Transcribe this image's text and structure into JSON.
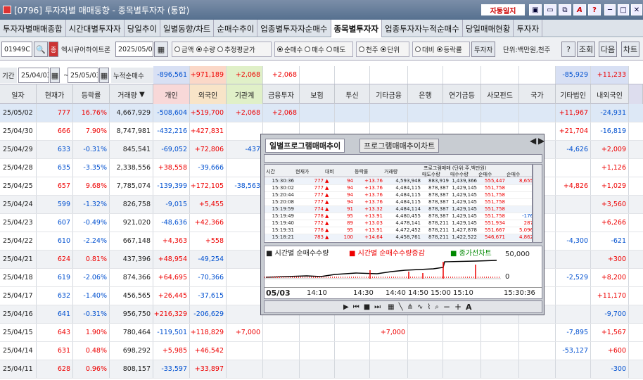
{
  "window": {
    "title": "[0796] 투자자별 매매동향 - 종목별투자자 (통합)",
    "btn_auto_lock": "자동일지",
    "btn_a": "A",
    "btn_q": "?"
  },
  "tabs": [
    "투자자별매매종합",
    "시간대별투자자",
    "당일추이",
    "일별동향/차트",
    "순매수추이",
    "업종별투자자순매수",
    "종목별투자자",
    "업종투자자누적순매수",
    "당일매매현황",
    "투자자"
  ],
  "toolbar": {
    "code": "01949C",
    "stock_name": "엑시큐어하이트론",
    "date": "2025/05/03",
    "r1_a": "금액",
    "r1_b": "수량",
    "r1_c": "추정평균가",
    "r2_a": "순매수",
    "r2_b": "매수",
    "r2_c": "매도",
    "r3_a": "천주",
    "r3_b": "단위",
    "r4_a": "대비",
    "r4_b": "등락률",
    "investor_btn": "투자자",
    "unit": "단위:백만원,천주",
    "help": "?",
    "query": "조회",
    "next": "다음",
    "chart": "차트"
  },
  "period": {
    "label": "기간",
    "from": "25/04/03",
    "to": "25/05/03",
    "tilde": "~",
    "cum_label": "누적순매수",
    "values": [
      "-896,561",
      "+971,189",
      "+2,068",
      "",
      "+2,068",
      "",
      "",
      "",
      "",
      "",
      "",
      "-85,929",
      "+11,233"
    ]
  },
  "columns": [
    "일자",
    "현재가",
    "등락률",
    "거래량",
    "개인",
    "외국인",
    "기관계",
    "금융투자",
    "보험",
    "투신",
    "기타금융",
    "은행",
    "연기금등",
    "사모펀드",
    "국가",
    "기타법인",
    "내외국인"
  ],
  "rows": [
    {
      "d": "25/05/02",
      "p": "777",
      "r": "16.76%",
      "v": "4,667,929",
      "i": "-508,604",
      "f": "+519,700",
      "g": "+2,068",
      "fi": "+2,068",
      "ins": "",
      "tr": "",
      "ef": "",
      "bk": "",
      "pn": "",
      "pe": "",
      "nt": "",
      "oc": "+11,967",
      "fo": "-24,931",
      "hl": true
    },
    {
      "d": "25/04/30",
      "p": "666",
      "r": "7.90%",
      "v": "8,747,981",
      "i": "-432,216",
      "f": "+427,831",
      "g": "",
      "fi": "",
      "oc": "+21,704",
      "fo": "-16,819"
    },
    {
      "d": "25/04/29",
      "p": "633",
      "r": "-0.31%",
      "v": "845,541",
      "i": "-69,052",
      "f": "+72,806",
      "g": "-437",
      "fi": "",
      "oc": "-4,626",
      "fo": "+2,009"
    },
    {
      "d": "25/04/28",
      "p": "635",
      "r": "-3.35%",
      "v": "2,338,556",
      "i": "+38,558",
      "f": "-39,666",
      "g": "",
      "fi": "",
      "oc": "",
      "fo": "+1,126"
    },
    {
      "d": "25/04/25",
      "p": "657",
      "r": "9.68%",
      "v": "7,785,074",
      "i": "-139,399",
      "f": "+172,105",
      "g": "-38,563",
      "fi": "",
      "oc": "+4,826",
      "fo": "+1,029"
    },
    {
      "d": "25/04/24",
      "p": "599",
      "r": "-1.32%",
      "v": "826,758",
      "i": "-9,015",
      "f": "+5,455",
      "g": "",
      "fi": "",
      "oc": "",
      "fo": "+3,560"
    },
    {
      "d": "25/04/23",
      "p": "607",
      "r": "-0.49%",
      "v": "921,020",
      "i": "-48,636",
      "f": "+42,366",
      "g": "",
      "fi": "",
      "oc": "",
      "fo": "+6,266"
    },
    {
      "d": "25/04/22",
      "p": "610",
      "r": "-2.24%",
      "v": "667,148",
      "i": "+4,363",
      "f": "+558",
      "g": "",
      "fi": "",
      "oc": "-4,300",
      "fo": "-621"
    },
    {
      "d": "25/04/21",
      "p": "624",
      "r": "0.81%",
      "v": "437,396",
      "i": "+48,954",
      "f": "-49,254",
      "g": "",
      "fi": "",
      "oc": "",
      "fo": "+300"
    },
    {
      "d": "25/04/18",
      "p": "619",
      "r": "-2.06%",
      "v": "874,366",
      "i": "+64,695",
      "f": "-70,366",
      "g": "",
      "fi": "",
      "oc": "-2,529",
      "fo": "+8,200"
    },
    {
      "d": "25/04/17",
      "p": "632",
      "r": "-1.40%",
      "v": "456,565",
      "i": "+26,445",
      "f": "-37,615",
      "g": "",
      "fi": "",
      "oc": "",
      "fo": "+11,170"
    },
    {
      "d": "25/04/16",
      "p": "641",
      "r": "-0.31%",
      "v": "956,750",
      "i": "+216,329",
      "f": "-206,629",
      "g": "",
      "fi": "",
      "oc": "",
      "fo": "-9,700"
    },
    {
      "d": "25/04/15",
      "p": "643",
      "r": "1.90%",
      "v": "780,464",
      "i": "-119,501",
      "f": "+118,829",
      "g": "+7,000",
      "fi": "",
      "ef": "+7,000",
      "oc": "-7,895",
      "fo": "+1,567"
    },
    {
      "d": "25/04/14",
      "p": "631",
      "r": "0.48%",
      "v": "698,292",
      "i": "+5,985",
      "f": "+46,542",
      "g": "",
      "fi": "",
      "oc": "-53,127",
      "fo": "+600"
    },
    {
      "d": "25/04/11",
      "p": "628",
      "r": "0.96%",
      "v": "808,157",
      "i": "-33,597",
      "f": "+33,897",
      "g": "",
      "fi": "",
      "oc": "",
      "fo": "-300"
    }
  ],
  "popup": {
    "tab1": "일별프로그램매매추이",
    "tab2": "프로그램매매추이차트",
    "cols": [
      "시간",
      "현재가",
      "대비",
      "등락률",
      "거래량",
      "매도수량",
      "매수수량",
      "순매수",
      "순매수"
    ],
    "group": "프로그램매매 (단위:주,백만원)",
    "prows": [
      [
        "15:30:36",
        "777",
        "94",
        "+13.76",
        "4,593,948",
        "883,919",
        "1,439,366",
        "555,447",
        "8,655"
      ],
      [
        "15:30:02",
        "777",
        "94",
        "+13.76",
        "4,484,115",
        "878,387",
        "1,429,145",
        "551,758",
        ""
      ],
      [
        "15:20:44",
        "777",
        "94",
        "+13.76",
        "4,484,115",
        "878,387",
        "1,429,145",
        "551,758",
        ""
      ],
      [
        "15:20:08",
        "777",
        "94",
        "+13.76",
        "4,484,115",
        "878,387",
        "1,429,145",
        "551,758",
        ""
      ],
      [
        "15:19:59",
        "774",
        "91",
        "+13.32",
        "4,484,114",
        "878,387",
        "1,429,145",
        "551,758",
        ""
      ],
      [
        "15:19:49",
        "778",
        "95",
        "+13.91",
        "4,480,455",
        "878,387",
        "1,429,145",
        "551,758",
        "-176"
      ],
      [
        "15:19:40",
        "772",
        "89",
        "+13.03",
        "4,478,141",
        "878,211",
        "1,429,145",
        "551,934",
        "287"
      ],
      [
        "15:19:31",
        "778",
        "95",
        "+13.91",
        "4,472,452",
        "878,211",
        "1,427,878",
        "551,667",
        "5,096"
      ],
      [
        "15:18:21",
        "783",
        "100",
        "+14.64",
        "4,458,761",
        "878,211",
        "1,422,522",
        "546,671",
        "4,862"
      ]
    ],
    "legend1": "시간별 순매수수량",
    "legend2": "시간별 순매수수량증감",
    "legend3": "종가선차트",
    "ymax": "50,000",
    "yzero": "0",
    "xdate": "05/03",
    "xticks": [
      "14:10",
      "14:30",
      "14:40",
      "14:50",
      "15:00",
      "15:10"
    ],
    "xend": "15:30:36"
  }
}
